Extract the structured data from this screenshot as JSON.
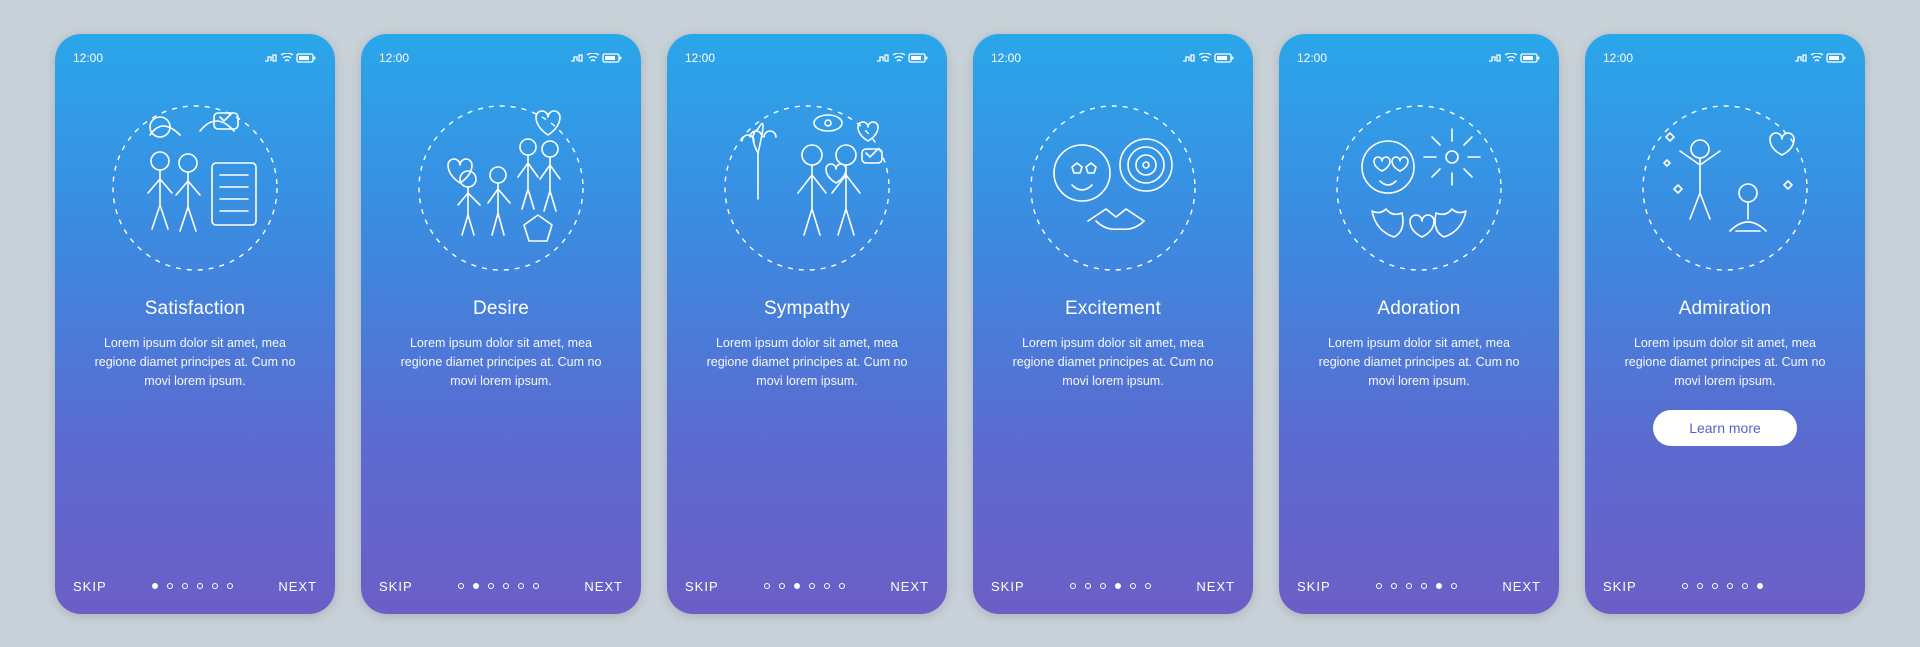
{
  "status": {
    "time": "12:00"
  },
  "common": {
    "skip": "SKIP",
    "next": "NEXT",
    "learn_more": "Learn more",
    "body": "Lorem ipsum dolor sit amet, mea regione diamet principes at. Cum no movi lorem ipsum."
  },
  "screens": [
    {
      "title": "Satisfaction",
      "active_dot": 0,
      "cta": false,
      "icon": "satisfaction-icon"
    },
    {
      "title": "Desire",
      "active_dot": 1,
      "cta": false,
      "icon": "desire-icon"
    },
    {
      "title": "Sympathy",
      "active_dot": 2,
      "cta": false,
      "icon": "sympathy-icon"
    },
    {
      "title": "Excitement",
      "active_dot": 3,
      "cta": false,
      "icon": "excitement-icon"
    },
    {
      "title": "Adoration",
      "active_dot": 4,
      "cta": false,
      "icon": "adoration-icon"
    },
    {
      "title": "Admiration",
      "active_dot": 5,
      "cta": true,
      "icon": "admiration-icon"
    }
  ],
  "total_dots": 6
}
